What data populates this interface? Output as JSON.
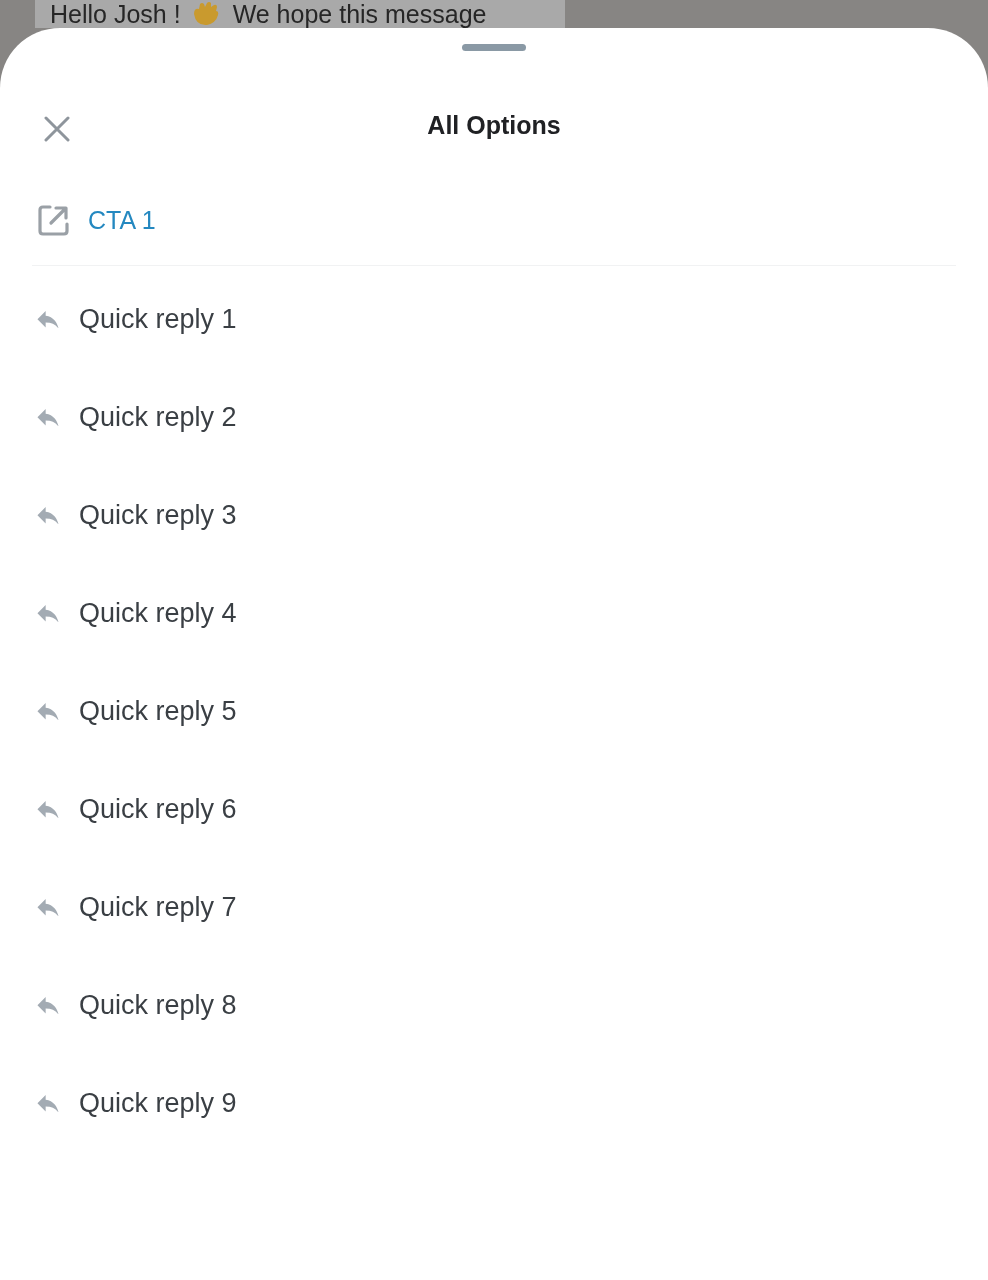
{
  "background_message": {
    "text_before": "Hello Josh !",
    "text_after": "We hope this message"
  },
  "sheet": {
    "title": "All Options"
  },
  "options": [
    {
      "kind": "link",
      "label": "CTA 1"
    },
    {
      "kind": "quick_reply",
      "label": "Quick reply 1"
    },
    {
      "kind": "quick_reply",
      "label": "Quick reply 2"
    },
    {
      "kind": "quick_reply",
      "label": "Quick reply 3"
    },
    {
      "kind": "quick_reply",
      "label": "Quick reply 4"
    },
    {
      "kind": "quick_reply",
      "label": "Quick reply 5"
    },
    {
      "kind": "quick_reply",
      "label": "Quick reply 6"
    },
    {
      "kind": "quick_reply",
      "label": "Quick reply 7"
    },
    {
      "kind": "quick_reply",
      "label": "Quick reply 8"
    },
    {
      "kind": "quick_reply",
      "label": "Quick reply 9"
    }
  ]
}
